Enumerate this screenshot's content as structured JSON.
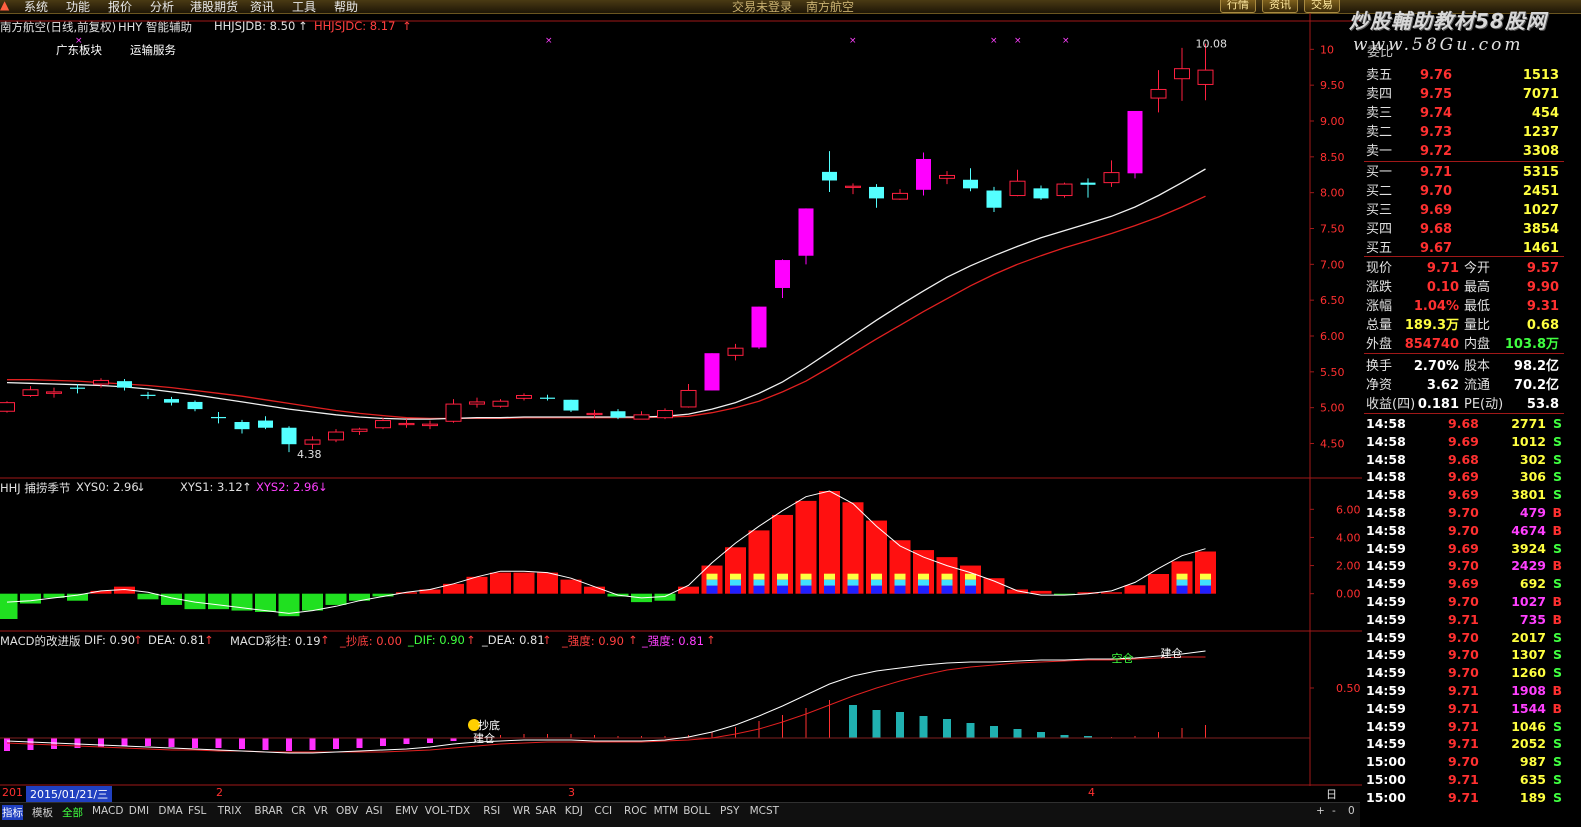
{
  "menubar": {
    "items": [
      "系统",
      "功能",
      "报价",
      "分析",
      "港股期货",
      "资讯",
      "工具",
      "帮助"
    ],
    "center_title_1": "交易未登录",
    "center_title_2": "南方航空",
    "right_tabs": [
      "行情",
      "资讯",
      "交易"
    ]
  },
  "watermark": {
    "line1": "炒股輔助教材58股网",
    "line2": "www.58Gu.com"
  },
  "main_chart": {
    "title": "南方航空(日线,前复权)",
    "indicator_name": "HHY 智能辅助",
    "hhjsjdb": "HHJSJDB: 8.50",
    "hhjsjdc": "HHJSJDC: 8.17",
    "sector_1": "广东板块",
    "sector_2": "运输服务",
    "high_label": "10.08",
    "low_label": "4.38",
    "y_ticks": [
      "10",
      "9.50",
      "9.00",
      "8.50",
      "8.00",
      "7.50",
      "7.00",
      "6.50",
      "6.00",
      "5.50",
      "5.00",
      "4.50"
    ],
    "colors": {
      "up": "#ff2040",
      "down": "#54ffff",
      "limit_up": "#ff00ff"
    }
  },
  "chart_data": [
    {
      "type": "candlestick",
      "title": "",
      "ylim": [
        4.2,
        10.2
      ],
      "candles": [
        [
          4.95,
          5.07,
          5.09,
          4.93
        ],
        [
          5.17,
          5.25,
          5.3,
          5.15
        ],
        [
          5.2,
          5.22,
          5.28,
          5.14
        ],
        [
          5.28,
          5.27,
          5.33,
          5.2
        ],
        [
          5.33,
          5.38,
          5.41,
          5.28
        ],
        [
          5.37,
          5.28,
          5.4,
          5.24
        ],
        [
          5.18,
          5.17,
          5.22,
          5.12
        ],
        [
          5.12,
          5.07,
          5.15,
          5.03
        ],
        [
          5.08,
          4.98,
          5.1,
          4.95
        ],
        [
          4.87,
          4.86,
          4.94,
          4.78
        ],
        [
          4.8,
          4.7,
          4.83,
          4.64
        ],
        [
          4.82,
          4.72,
          4.88,
          4.7
        ],
        [
          4.72,
          4.49,
          4.74,
          4.38
        ],
        [
          4.49,
          4.55,
          4.6,
          4.42
        ],
        [
          4.55,
          4.66,
          4.7,
          4.52
        ],
        [
          4.67,
          4.7,
          4.72,
          4.62
        ],
        [
          4.72,
          4.82,
          4.86,
          4.7
        ],
        [
          4.77,
          4.78,
          4.84,
          4.72
        ],
        [
          4.75,
          4.77,
          4.82,
          4.7
        ],
        [
          4.81,
          5.05,
          5.12,
          4.79
        ],
        [
          5.05,
          5.08,
          5.14,
          5.0
        ],
        [
          5.02,
          5.09,
          5.12,
          5.0
        ],
        [
          5.13,
          5.17,
          5.2,
          5.1
        ],
        [
          5.14,
          5.13,
          5.18,
          5.1
        ],
        [
          5.11,
          4.96,
          5.11,
          4.94
        ],
        [
          4.91,
          4.92,
          4.97,
          4.86
        ],
        [
          4.95,
          4.86,
          4.98,
          4.84
        ],
        [
          4.84,
          4.9,
          4.95,
          4.84
        ],
        [
          4.86,
          4.96,
          4.99,
          4.84
        ],
        [
          5.01,
          5.24,
          5.33,
          5.0
        ],
        [
          5.24,
          5.76,
          5.76,
          5.24
        ],
        [
          5.73,
          5.83,
          5.89,
          5.66
        ],
        [
          5.84,
          6.41,
          6.41,
          5.82
        ],
        [
          6.67,
          7.06,
          7.07,
          6.53
        ],
        [
          7.12,
          7.78,
          7.78,
          7.0
        ],
        [
          8.29,
          8.17,
          8.58,
          8.01
        ],
        [
          8.09,
          8.09,
          8.13,
          7.98
        ],
        [
          8.08,
          7.92,
          8.12,
          7.79
        ],
        [
          7.91,
          7.99,
          8.05,
          7.9
        ],
        [
          8.04,
          8.47,
          8.56,
          7.96
        ],
        [
          8.2,
          8.24,
          8.3,
          8.12
        ],
        [
          8.18,
          8.06,
          8.34,
          8.02
        ],
        [
          8.03,
          7.79,
          8.08,
          7.73
        ],
        [
          7.96,
          8.16,
          8.32,
          7.95
        ],
        [
          8.06,
          7.92,
          8.1,
          7.9
        ],
        [
          7.96,
          8.12,
          8.14,
          7.93
        ],
        [
          8.14,
          8.11,
          8.2,
          7.93
        ],
        [
          8.14,
          8.28,
          8.45,
          8.08
        ],
        [
          8.27,
          9.14,
          9.14,
          8.2
        ],
        [
          9.32,
          9.44,
          9.71,
          9.12
        ],
        [
          9.59,
          9.73,
          10.02,
          9.28
        ],
        [
          9.51,
          9.71,
          10.08,
          9.29
        ]
      ],
      "ma_white": [
        5.35,
        5.34,
        5.33,
        5.32,
        5.31,
        5.29,
        5.26,
        5.22,
        5.18,
        5.13,
        5.08,
        5.03,
        4.98,
        4.94,
        4.9,
        4.87,
        4.85,
        4.84,
        4.84,
        4.85,
        4.86,
        4.86,
        4.87,
        4.87,
        4.87,
        4.87,
        4.87,
        4.87,
        4.88,
        4.91,
        4.98,
        5.07,
        5.2,
        5.36,
        5.56,
        5.78,
        6.0,
        6.22,
        6.43,
        6.63,
        6.82,
        6.98,
        7.12,
        7.25,
        7.37,
        7.47,
        7.57,
        7.67,
        7.8,
        7.96,
        8.14,
        8.33
      ],
      "ma_red": [
        5.39,
        5.39,
        5.38,
        5.37,
        5.35,
        5.33,
        5.31,
        5.28,
        5.24,
        5.2,
        5.16,
        5.11,
        5.06,
        5.01,
        4.96,
        4.92,
        4.89,
        4.86,
        4.85,
        4.85,
        4.85,
        4.85,
        4.86,
        4.86,
        4.86,
        4.86,
        4.86,
        4.86,
        4.87,
        4.88,
        4.93,
        5.0,
        5.09,
        5.22,
        5.37,
        5.56,
        5.76,
        5.96,
        6.15,
        6.34,
        6.52,
        6.7,
        6.86,
        7.0,
        7.12,
        7.23,
        7.33,
        7.43,
        7.54,
        7.66,
        7.8,
        7.95
      ]
    },
    {
      "type": "bar",
      "title": "",
      "indicator_name": "HHJ 捕捞季节",
      "xys0": "XYS0: 2.96",
      "xys1": "XYS1: 3.12",
      "xys2": "XYS2: 2.96",
      "ylim": [
        -1.8,
        7.8
      ],
      "y_ticks": [
        "6.00",
        "4.00",
        "2.00",
        "0.00"
      ],
      "values": [
        -1.8,
        -0.7,
        -0.3,
        -0.5,
        0.2,
        0.5,
        -0.4,
        -0.8,
        -1.1,
        -1.1,
        -1.2,
        -1.3,
        -1.6,
        -1.2,
        -0.8,
        -0.5,
        -0.2,
        0.1,
        0.3,
        0.7,
        1.2,
        1.5,
        1.5,
        1.5,
        1.0,
        0.5,
        -0.2,
        -0.6,
        -0.5,
        0.5,
        2.0,
        3.3,
        4.5,
        5.6,
        6.6,
        7.3,
        6.5,
        5.2,
        3.8,
        3.1,
        2.6,
        2.0,
        1.1,
        0.3,
        0.2,
        -0.1,
        0.1,
        0.1,
        0.6,
        1.4,
        2.3,
        3.0,
        3.0
      ],
      "signal_line": [
        -0.6,
        -0.5,
        -0.3,
        -0.1,
        0.2,
        0.3,
        0.1,
        -0.3,
        -0.6,
        -0.8,
        -1.0,
        -1.2,
        -1.4,
        -1.2,
        -0.9,
        -0.5,
        -0.2,
        0.1,
        0.3,
        0.7,
        1.2,
        1.6,
        1.6,
        1.5,
        1.1,
        0.5,
        -0.1,
        -0.3,
        -0.2,
        0.6,
        2.2,
        3.6,
        4.8,
        5.9,
        6.9,
        7.3,
        6.4,
        4.8,
        3.4,
        2.6,
        2.0,
        1.5,
        0.9,
        0.2,
        -0.1,
        -0.1,
        0.0,
        0.2,
        0.8,
        1.8,
        2.7,
        3.2,
        3.1
      ]
    },
    {
      "type": "bar",
      "title": "",
      "indicator_name": "MACD的改进版",
      "dif": "DIF: 0.90",
      "dea": "DEA: 0.81",
      "macd_bar": "MACD彩柱: 0.19",
      "chaodi": "_抄底: 0.00",
      "dif2": "_DIF: 0.90",
      "dea2": "_DEA: 0.81",
      "qiangdu1": "_强度: 0.90",
      "qiangdu2": "_强度: 0.81",
      "ylim": [
        -0.35,
        1.0
      ],
      "y_ticks": [
        "0.50"
      ],
      "values": [
        -0.13,
        -0.12,
        -0.11,
        -0.1,
        -0.09,
        -0.08,
        -0.08,
        -0.09,
        -0.1,
        -0.1,
        -0.11,
        -0.12,
        -0.13,
        -0.12,
        -0.11,
        -0.1,
        -0.08,
        -0.06,
        -0.05,
        -0.03,
        0.02,
        0.03,
        0.04,
        0.04,
        0.04,
        0.03,
        0.02,
        0.02,
        0.02,
        0.03,
        0.06,
        0.11,
        0.17,
        0.23,
        0.3,
        0.38,
        0.33,
        0.28,
        0.26,
        0.22,
        0.19,
        0.15,
        0.12,
        0.09,
        0.06,
        0.03,
        0.02,
        0.01,
        0.02,
        0.06,
        0.1,
        0.13,
        0.19
      ],
      "dif_line": [
        -0.03,
        -0.04,
        -0.05,
        -0.06,
        -0.07,
        -0.08,
        -0.09,
        -0.1,
        -0.11,
        -0.12,
        -0.13,
        -0.14,
        -0.15,
        -0.15,
        -0.14,
        -0.13,
        -0.12,
        -0.11,
        -0.09,
        -0.06,
        -0.04,
        -0.03,
        -0.02,
        -0.02,
        -0.02,
        -0.03,
        -0.03,
        -0.03,
        -0.02,
        0.01,
        0.06,
        0.13,
        0.22,
        0.32,
        0.43,
        0.54,
        0.62,
        0.67,
        0.7,
        0.73,
        0.75,
        0.76,
        0.76,
        0.77,
        0.78,
        0.78,
        0.79,
        0.79,
        0.8,
        0.82,
        0.84,
        0.87,
        0.9
      ],
      "dea_line": [
        -0.05,
        -0.06,
        -0.07,
        -0.08,
        -0.09,
        -0.1,
        -0.11,
        -0.12,
        -0.12,
        -0.13,
        -0.13,
        -0.14,
        -0.14,
        -0.14,
        -0.14,
        -0.14,
        -0.14,
        -0.13,
        -0.12,
        -0.1,
        -0.08,
        -0.06,
        -0.05,
        -0.04,
        -0.04,
        -0.04,
        -0.04,
        -0.04,
        -0.03,
        -0.02,
        0.0,
        0.04,
        0.09,
        0.16,
        0.24,
        0.33,
        0.42,
        0.5,
        0.57,
        0.63,
        0.68,
        0.71,
        0.73,
        0.75,
        0.76,
        0.77,
        0.78,
        0.78,
        0.79,
        0.8,
        0.81,
        0.81,
        0.81
      ],
      "marker_1": "抄底",
      "marker_2": "建仓",
      "marker_3": "空仓",
      "marker_4": "建仓"
    }
  ],
  "date_bar": {
    "year_label": "201",
    "date": "2015/01/21/三",
    "month_ticks": [
      "2",
      "3",
      "4"
    ],
    "period": "日线"
  },
  "quote": {
    "top_partial": "委比",
    "asks": [
      {
        "label": "卖五",
        "price": "9.76",
        "vol": "1513"
      },
      {
        "label": "卖四",
        "price": "9.75",
        "vol": "7071"
      },
      {
        "label": "卖三",
        "price": "9.74",
        "vol": "454"
      },
      {
        "label": "卖二",
        "price": "9.73",
        "vol": "1237"
      },
      {
        "label": "卖一",
        "price": "9.72",
        "vol": "3308"
      }
    ],
    "bids": [
      {
        "label": "买一",
        "price": "9.71",
        "vol": "5315"
      },
      {
        "label": "买二",
        "price": "9.70",
        "vol": "2451"
      },
      {
        "label": "买三",
        "price": "9.69",
        "vol": "1027"
      },
      {
        "label": "买四",
        "price": "9.68",
        "vol": "3854"
      },
      {
        "label": "买五",
        "price": "9.67",
        "vol": "1461"
      }
    ],
    "stats": [
      {
        "l1": "现价",
        "v1": "9.71",
        "l2": "今开",
        "v2": "9.57"
      },
      {
        "l1": "涨跌",
        "v1": "0.10",
        "l2": "最高",
        "v2": "9.90"
      },
      {
        "l1": "涨幅",
        "v1": "1.04%",
        "l2": "最低",
        "v2": "9.31"
      },
      {
        "l1": "总量",
        "v1": "189.3万",
        "l2": "量比",
        "v2": "0.68"
      },
      {
        "l1": "外盘",
        "v1": "854740",
        "l2": "内盘",
        "v2": "103.8万"
      }
    ],
    "stats2": [
      {
        "l1": "换手",
        "v1": "2.70%",
        "l2": "股本",
        "v2": "98.2亿"
      },
      {
        "l1": "净资",
        "v1": "3.62",
        "l2": "流通",
        "v2": "70.2亿"
      },
      {
        "l1": "收益(四)",
        "v1": "0.181",
        "l2": "PE(动)",
        "v2": "53.8"
      }
    ],
    "ticks": [
      {
        "t": "14:58",
        "p": "9.68",
        "v": "2771",
        "s": "S"
      },
      {
        "t": "14:58",
        "p": "9.69",
        "v": "1012",
        "s": "S"
      },
      {
        "t": "14:58",
        "p": "9.68",
        "v": "302",
        "s": "S"
      },
      {
        "t": "14:58",
        "p": "9.69",
        "v": "306",
        "s": "S"
      },
      {
        "t": "14:58",
        "p": "9.69",
        "v": "3801",
        "s": "S"
      },
      {
        "t": "14:58",
        "p": "9.70",
        "v": "479",
        "s": "B"
      },
      {
        "t": "14:58",
        "p": "9.70",
        "v": "4674",
        "s": "B"
      },
      {
        "t": "14:59",
        "p": "9.69",
        "v": "3924",
        "s": "S"
      },
      {
        "t": "14:59",
        "p": "9.70",
        "v": "2429",
        "s": "B"
      },
      {
        "t": "14:59",
        "p": "9.69",
        "v": "692",
        "s": "S"
      },
      {
        "t": "14:59",
        "p": "9.70",
        "v": "1027",
        "s": "B"
      },
      {
        "t": "14:59",
        "p": "9.71",
        "v": "735",
        "s": "B"
      },
      {
        "t": "14:59",
        "p": "9.70",
        "v": "2017",
        "s": "S"
      },
      {
        "t": "14:59",
        "p": "9.70",
        "v": "1307",
        "s": "S"
      },
      {
        "t": "14:59",
        "p": "9.70",
        "v": "1260",
        "s": "S"
      },
      {
        "t": "14:59",
        "p": "9.71",
        "v": "1908",
        "s": "B"
      },
      {
        "t": "14:59",
        "p": "9.71",
        "v": "1544",
        "s": "B"
      },
      {
        "t": "14:59",
        "p": "9.71",
        "v": "1046",
        "s": "S"
      },
      {
        "t": "14:59",
        "p": "9.71",
        "v": "2052",
        "s": "S"
      },
      {
        "t": "15:00",
        "p": "9.70",
        "v": "987",
        "s": "S"
      },
      {
        "t": "15:00",
        "p": "9.71",
        "v": "635",
        "s": "S"
      },
      {
        "t": "15:00",
        "p": "9.71",
        "v": "189",
        "s": "S"
      }
    ]
  },
  "bottom_tabs": [
    "指标",
    "模板",
    "全部",
    "MACD",
    "DMI",
    "DMA",
    "FSL",
    "TRIX",
    "BRAR",
    "CR",
    "VR",
    "OBV",
    "ASI",
    "EMV",
    "VOL-TDX",
    "RSI",
    "WR",
    "SAR",
    "KDJ",
    "CCI",
    "ROC",
    "MTM",
    "BOLL",
    "PSY",
    "MCST"
  ],
  "bottom_right": [
    "+",
    "-",
    "0"
  ]
}
